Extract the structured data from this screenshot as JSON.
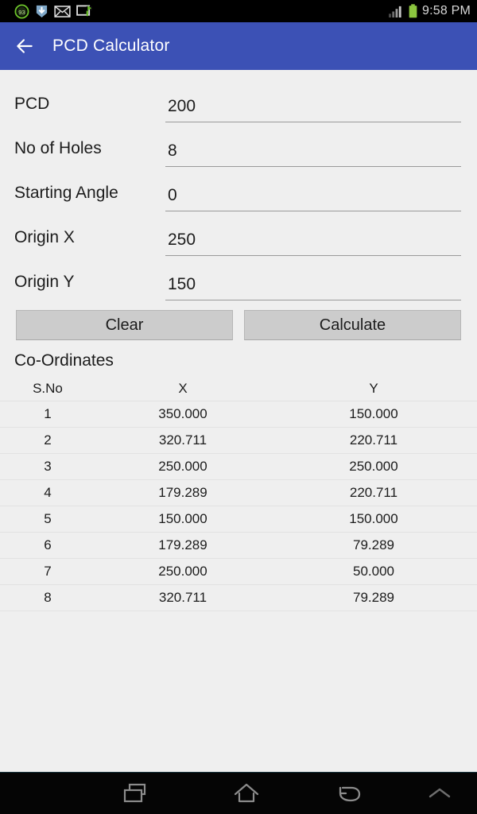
{
  "status_bar": {
    "icons": [
      "badge-93-icon",
      "download-icon",
      "mail-icon",
      "screen-share-icon"
    ],
    "badge_text": "93",
    "signal_icon": "signal-bars-icon",
    "battery_icon": "battery-full-icon",
    "time": "9:58 PM"
  },
  "app_bar": {
    "back_icon": "back-arrow-icon",
    "title": "PCD Calculator",
    "color": "#3c51b5"
  },
  "form": {
    "fields": [
      {
        "label": "PCD",
        "value": "200"
      },
      {
        "label": "No of Holes",
        "value": "8"
      },
      {
        "label": "Starting Angle",
        "value": "0"
      },
      {
        "label": "Origin X",
        "value": "250"
      },
      {
        "label": "Origin Y",
        "value": "150"
      }
    ]
  },
  "buttons": {
    "clear_label": "Clear",
    "calculate_label": "Calculate"
  },
  "coordinates": {
    "title": "Co-Ordinates",
    "columns": [
      "S.No",
      "X",
      "Y"
    ],
    "rows": [
      [
        "1",
        "350.000",
        "150.000"
      ],
      [
        "2",
        "320.711",
        "220.711"
      ],
      [
        "3",
        "250.000",
        "250.000"
      ],
      [
        "4",
        "179.289",
        "220.711"
      ],
      [
        "5",
        "150.000",
        "150.000"
      ],
      [
        "6",
        "179.289",
        "79.289"
      ],
      [
        "7",
        "250.000",
        "50.000"
      ],
      [
        "8",
        "320.711",
        "79.289"
      ]
    ]
  },
  "nav_bar": {
    "recent_icon": "recent-apps-icon",
    "home_icon": "home-icon",
    "back_icon": "back-icon",
    "up_icon": "chevron-up-icon"
  }
}
